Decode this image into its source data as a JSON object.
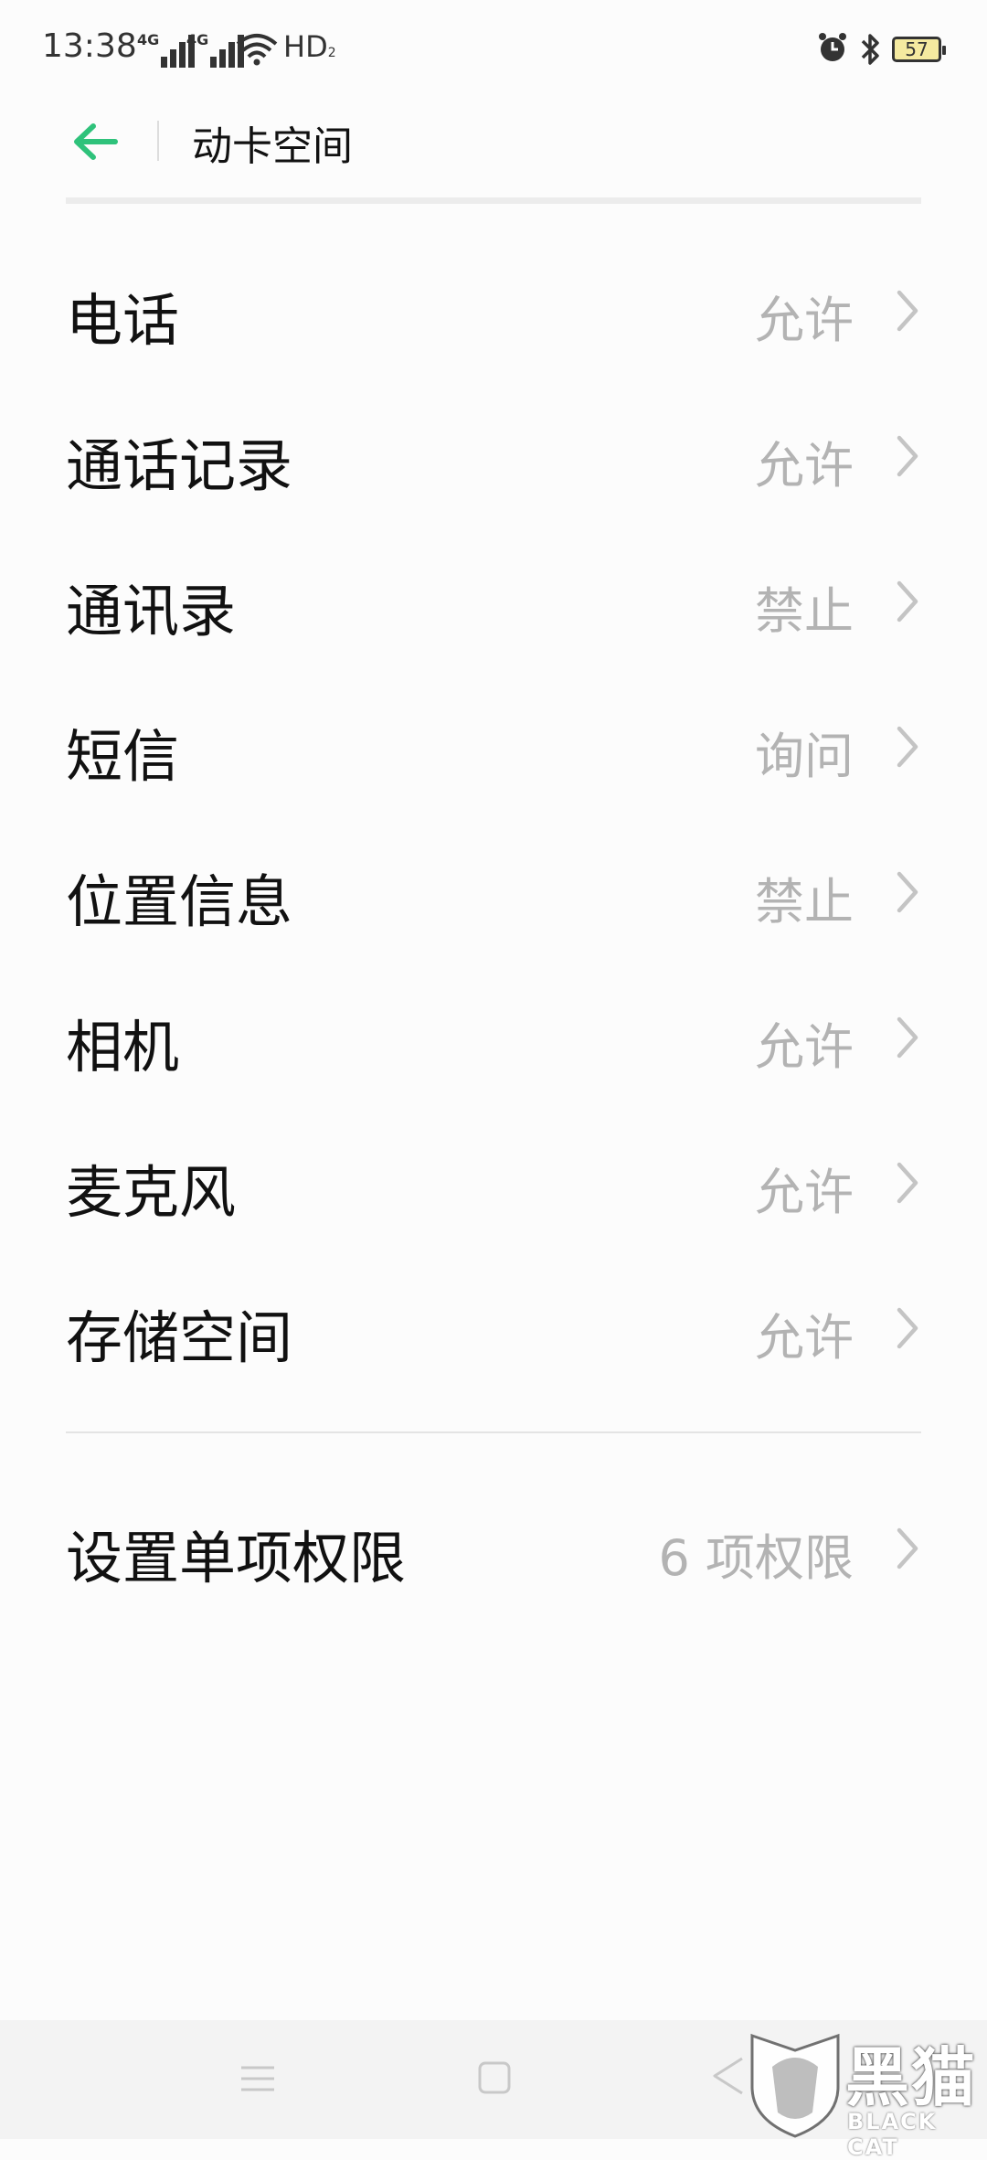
{
  "status_bar": {
    "time": "13:38",
    "network_1": "4G",
    "network_2": "4G",
    "hd": "HD",
    "hd_sub": "2",
    "battery": "57"
  },
  "header": {
    "title": "动卡空间",
    "accent_color": "#2fc27b"
  },
  "permissions": [
    {
      "label": "电话",
      "value": "允许"
    },
    {
      "label": "通话记录",
      "value": "允许"
    },
    {
      "label": "通讯录",
      "value": "禁止"
    },
    {
      "label": "短信",
      "value": "询问"
    },
    {
      "label": "位置信息",
      "value": "禁止"
    },
    {
      "label": "相机",
      "value": "允许"
    },
    {
      "label": "麦克风",
      "value": "允许"
    },
    {
      "label": "存储空间",
      "value": "允许"
    }
  ],
  "single_permission": {
    "label": "设置单项权限",
    "value": "6 项权限"
  },
  "watermark": {
    "cn": "黑猫",
    "en": "BLACK CAT"
  },
  "icons": {
    "back": "arrow-left-icon",
    "chevron": "chevron-right-icon",
    "alarm": "alarm-icon",
    "bluetooth": "bluetooth-icon",
    "wifi": "wifi-icon",
    "nav_menu": "menu-icon",
    "nav_home": "home-icon",
    "nav_back": "back-triangle-icon"
  }
}
